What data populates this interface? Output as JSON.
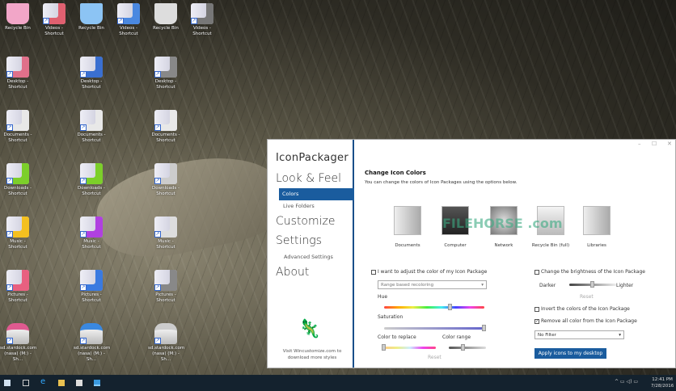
{
  "desktop": {
    "icons": [
      {
        "label": "Recycle Bin",
        "kind": "bin",
        "color": "#f2a6c8"
      },
      {
        "label": "Videos - Shortcut",
        "kind": "folder",
        "color": "#e06070"
      },
      {
        "label": "Recycle Bin",
        "kind": "bin",
        "color": "#8cc4f4"
      },
      {
        "label": "Videos - Shortcut",
        "kind": "folder",
        "color": "#4a88e0"
      },
      {
        "label": "Recycle Bin",
        "kind": "bin",
        "color": "#dddddd"
      },
      {
        "label": "Videos - Shortcut",
        "kind": "folder",
        "color": "#777777"
      },
      {
        "label": "Desktop - Shortcut",
        "kind": "folder",
        "color": "#e0708a"
      },
      {
        "label": "Desktop - Shortcut",
        "kind": "folder",
        "color": "#3a6fd0"
      },
      {
        "label": "Desktop - Shortcut",
        "kind": "folder",
        "color": "#888888"
      },
      {
        "label": "Documents - Shortcut",
        "kind": "folder",
        "color": "#e8e8e8"
      },
      {
        "label": "Documents - Shortcut",
        "kind": "folder",
        "color": "#e8e8e8"
      },
      {
        "label": "Documents - Shortcut",
        "kind": "folder",
        "color": "#e8e8e8"
      },
      {
        "label": "Downloads - Shortcut",
        "kind": "folder",
        "color": "#7ccf2a"
      },
      {
        "label": "Downloads - Shortcut",
        "kind": "folder",
        "color": "#7ccf2a"
      },
      {
        "label": "Downloads - Shortcut",
        "kind": "folder",
        "color": "#cccccc"
      },
      {
        "label": "Music - Shortcut",
        "kind": "folder",
        "color": "#f4c020"
      },
      {
        "label": "Music - Shortcut",
        "kind": "folder",
        "color": "#b040e0"
      },
      {
        "label": "Music - Shortcut",
        "kind": "folder",
        "color": "#dddddd"
      },
      {
        "label": "Pictures - Shortcut",
        "kind": "folder",
        "color": "#e86080"
      },
      {
        "label": "Pictures - Shortcut",
        "kind": "folder",
        "color": "#3a7ae0"
      },
      {
        "label": "Pictures - Shortcut",
        "kind": "folder",
        "color": "#888888"
      },
      {
        "label": "sd.stardock.com (nasa) (M:) - Sh...",
        "kind": "drive",
        "color": "#e05a90"
      },
      {
        "label": "sd.stardock.com (nasa) (M:) - Sh...",
        "kind": "drive",
        "color": "#3a88e0"
      },
      {
        "label": "sd.stardock.com (nasa) (M:) - Sh...",
        "kind": "drive",
        "color": "#cccccc"
      }
    ]
  },
  "app": {
    "logo": "IconPackager",
    "window_controls": [
      "–",
      "☐",
      "✕"
    ],
    "nav": {
      "look_feel": "Look & Feel",
      "colors": "Colors",
      "live_folders": "Live Folders",
      "customize": "Customize",
      "settings": "Settings",
      "advanced": "Advanced Settings",
      "about": "About"
    },
    "promo": "Visit Wincustomize.com to download more styles",
    "accent": "#1a5c9e"
  },
  "main": {
    "title": "Change Icon Colors",
    "desc": "You can change the colors of Icon Packages using the options below.",
    "previews": [
      "Documents",
      "Computer",
      "Network",
      "Recycle Bin (full)",
      "Libraries"
    ],
    "watermark": "FILEHORSE .com",
    "adjust_label": "I want to adjust the color of my Icon Package",
    "adjust_checked": false,
    "mode_select": "Range based recoloring",
    "hue_label": "Hue",
    "hue_value": 0.66,
    "saturation_label": "Saturation",
    "saturation_value": 1.0,
    "replace_label": "Color to replace",
    "replace_value": 0.0,
    "range_label": "Color range",
    "range_value": 0.4,
    "reset": "Reset",
    "brightness_label": "Change the brightness of the Icon Package",
    "brightness_checked": false,
    "darker": "Darker",
    "lighter": "Lighter",
    "brightness_value": 0.5,
    "reset2": "Reset",
    "invert_label": "Invert the colors of the Icon Package",
    "invert_checked": false,
    "remove_label": "Remove all color from the Icon Package",
    "remove_checked": true,
    "filter_select": "No Filter",
    "apply": "Apply icons to my desktop"
  },
  "taskbar": {
    "time": "12:41 PM",
    "date": "7/28/2016",
    "tray": "^ ▭ ◁) ▭"
  }
}
